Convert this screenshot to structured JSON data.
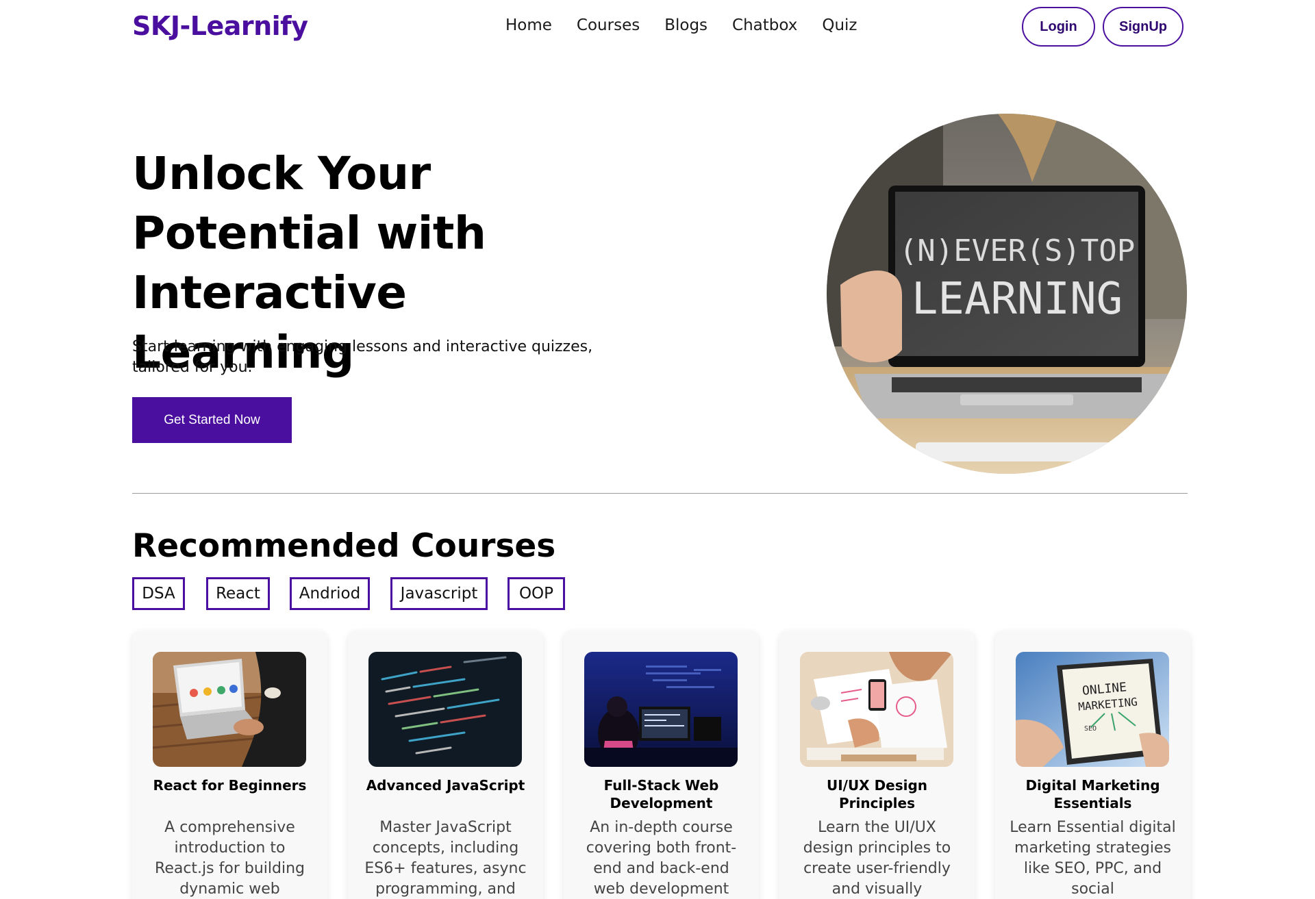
{
  "brand": {
    "logo": "SKJ-Learnify",
    "accent": "#4b0f9f"
  },
  "nav": {
    "links": [
      "Home",
      "Courses",
      "Blogs",
      "Chatbox",
      "Quiz"
    ],
    "login": "Login",
    "signup": "SignUp"
  },
  "hero": {
    "title": "Unlock Your Potential with Interactive Learning",
    "subtitle": "Start learning with engaging lessons and interactive quizzes, tailored for you.",
    "cta": "Get Started Now",
    "image_text_line1": "(N)EVER(S)TOP",
    "image_text_line2": "LEARNING"
  },
  "recommended": {
    "title": "Recommended Courses",
    "chips": [
      "DSA",
      "React",
      "Andriod",
      "Javascript",
      "OOP"
    ],
    "cards": [
      {
        "title": "React for Beginners",
        "description": "A comprehensive introduction to React.js for building dynamic web",
        "image_icon": "laptop-workspace-photo"
      },
      {
        "title": "Advanced JavaScript",
        "description": "Master JavaScript concepts, including ES6+ features, async programming, and",
        "image_icon": "code-screen-photo"
      },
      {
        "title": "Full-Stack Web Development",
        "description": "An in-depth course covering both front-end and back-end web development",
        "image_icon": "developer-desk-photo"
      },
      {
        "title": "UI/UX Design Principles",
        "description": "Learn the UI/UX design principles to create user-friendly and visually",
        "image_icon": "design-sketch-photo"
      },
      {
        "title": "Digital Marketing Essentials",
        "description": "Learn Essential digital marketing strategies like SEO, PPC, and social",
        "image_icon": "online-marketing-tablet-photo",
        "image_text_line1": "ONLINE",
        "image_text_line2": "MARKETING",
        "image_text_line3": "SEO"
      }
    ]
  }
}
